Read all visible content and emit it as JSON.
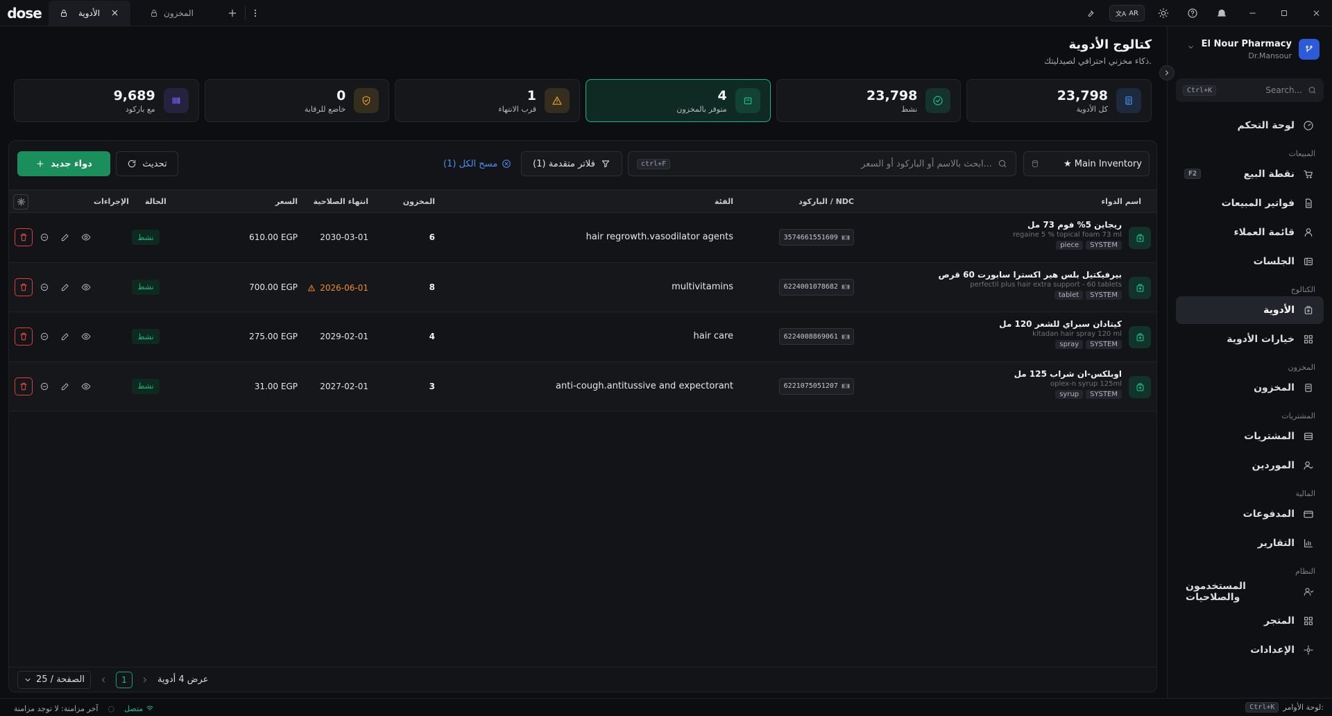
{
  "app": {
    "logo": "dose"
  },
  "tabs": [
    {
      "label": "الأدوية",
      "active": true
    },
    {
      "label": "المخزون",
      "active": false
    }
  ],
  "topbar": {
    "lang": "AR"
  },
  "sidebar": {
    "brand_name": "El Nour Pharmacy",
    "brand_user": "Dr.Mansour",
    "search_placeholder": "Search...",
    "search_kbd": "Ctrl+K",
    "items": [
      {
        "section": "",
        "label": "لوحة التحكم",
        "icon": "dashboard-icon"
      },
      {
        "section": "المبيعات",
        "label": "نقطة البيع",
        "icon": "cart-icon",
        "hint": "F2"
      },
      {
        "section": "",
        "label": "فواتير المبيعات",
        "icon": "invoice-icon"
      },
      {
        "section": "",
        "label": "قائمة العملاء",
        "icon": "user-icon"
      },
      {
        "section": "",
        "label": "الجلسات",
        "icon": "session-icon"
      },
      {
        "section": "الكتالوج",
        "label": "الأدوية",
        "icon": "medicine-icon",
        "active": true
      },
      {
        "section": "",
        "label": "خيارات الأدوية",
        "icon": "grid-icon"
      },
      {
        "section": "المخزون",
        "label": "المخزون",
        "icon": "inventory-icon"
      },
      {
        "section": "المشتريات",
        "label": "المشتريات",
        "icon": "purchases-icon"
      },
      {
        "section": "",
        "label": "الموردين",
        "icon": "supplier-icon"
      },
      {
        "section": "المالية",
        "label": "المدفوعات",
        "icon": "card-icon"
      },
      {
        "section": "",
        "label": "التقارير",
        "icon": "report-icon"
      },
      {
        "section": "النظام",
        "label": "المستخدمون والصلاحيات",
        "icon": "users-icon"
      },
      {
        "section": "",
        "label": "المتجر",
        "icon": "store-icon"
      },
      {
        "section": "",
        "label": "الإعدادات",
        "icon": "settings-icon"
      }
    ]
  },
  "page": {
    "title": "كتالوج الأدوية",
    "subtitle": "ذكاء مخزني احترافي لصيدليتك."
  },
  "stats": [
    {
      "value": "9,689",
      "label": "مع باركود",
      "color": "#7c5cf0",
      "icon": "barcode-icon"
    },
    {
      "value": "0",
      "label": "خاضع للرقابة",
      "color": "#e0a030",
      "icon": "shield-icon"
    },
    {
      "value": "1",
      "label": "قرب الانتهاء",
      "color": "#e0a030",
      "icon": "warning-icon"
    },
    {
      "value": "4",
      "label": "متوفر بالمخزون",
      "color": "#1fbf86",
      "icon": "box-icon",
      "active": true
    },
    {
      "value": "23,798",
      "label": "نشط",
      "color": "#1fbf86",
      "icon": "check-circle-icon"
    },
    {
      "value": "23,798",
      "label": "كل الأدوية",
      "color": "#4c8ff0",
      "icon": "list-icon"
    }
  ],
  "toolbar": {
    "new_label": "دواء جديد",
    "refresh_label": "تحديث",
    "clear_label": "مسح الكل (1)",
    "filter_label": "فلاتر متقدمة (1)",
    "search_placeholder": "ابحث بالاسم أو الباركود أو السعر...",
    "search_kbd": "ctrl+F",
    "inventory": "★ Main Inventory"
  },
  "table": {
    "headers": {
      "name": "اسم الدواء",
      "barcode": "الباركود / NDC",
      "category": "الفئة",
      "stock": "المخزون",
      "expiry": "انتهاء الصلاحية",
      "price": "السعر",
      "status": "الحالة",
      "actions": "الإجراءات"
    },
    "rows": [
      {
        "name_ar": "ريجاين 5% فوم 73 مل",
        "name_en": "regaine 5 % topical foam 73 ml",
        "form": "piece",
        "source": "SYSTEM",
        "barcode": "3574661551609",
        "category": "hair regrowth.vasodilator agents",
        "stock": "6",
        "expiry": "2030-03-01",
        "expiry_warn": false,
        "price": "610.00 EGP",
        "status": "نشط"
      },
      {
        "name_ar": "بيرفيكتيل بلس هير اكسترا سابورت 60 قرص",
        "name_en": "perfectil plus hair extra support - 60 tablets",
        "form": "tablet",
        "source": "SYSTEM",
        "barcode": "6224001078682",
        "category": "multivitamins",
        "stock": "8",
        "expiry": "2026-06-01",
        "expiry_warn": true,
        "price": "700.00 EGP",
        "status": "نشط"
      },
      {
        "name_ar": "كيتادان سبراي للشعر 120 مل",
        "name_en": "kitadan hair spray 120 ml",
        "form": "spray",
        "source": "SYSTEM",
        "barcode": "6224008869061",
        "category": "hair care",
        "stock": "4",
        "expiry": "2029-02-01",
        "expiry_warn": false,
        "price": "275.00 EGP",
        "status": "نشط"
      },
      {
        "name_ar": "اوبلكس-ان شراب 125 مل",
        "name_en": "oplex-n syrup 125ml",
        "form": "syrup",
        "source": "SYSTEM",
        "barcode": "6221075051207",
        "category": "anti-cough.antitussive and expectorant",
        "stock": "3",
        "expiry": "2027-02-01",
        "expiry_warn": false,
        "price": "31.00 EGP",
        "status": "نشط"
      }
    ]
  },
  "pager": {
    "showing": "عرض 4 أدوية",
    "page": "1",
    "per_page": "25 / الصفحة"
  },
  "statusbar": {
    "last_sync": "آخر مزامنة: لا توجد مزامنة",
    "online": "متصل",
    "commands_label": "لوحة الأوامر:",
    "commands_kbd": "Ctrl+K"
  }
}
